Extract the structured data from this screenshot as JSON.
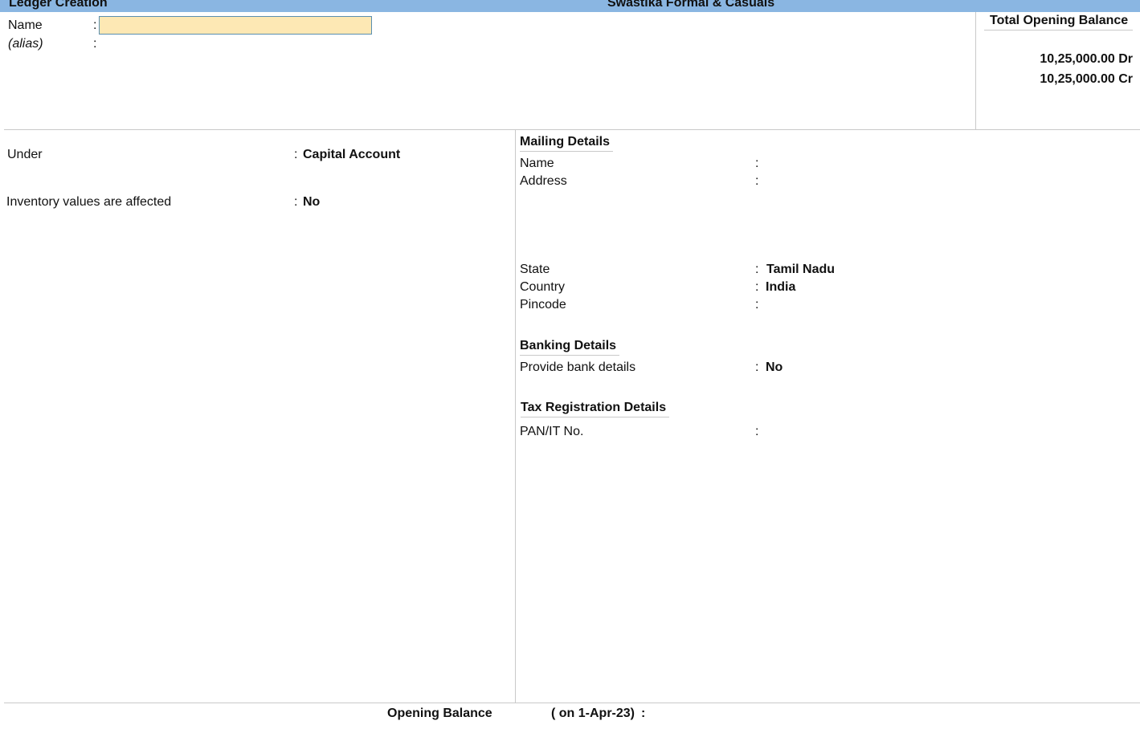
{
  "title_bar": {
    "screen_title": "Ledger Creation",
    "company_name": "Swastika Formal & Casuals"
  },
  "header": {
    "name_label": "Name",
    "alias_label": "(alias)",
    "separator": ":",
    "name_value": ""
  },
  "opening_balance_panel": {
    "title": "Total Opening Balance",
    "debit_total": "10,25,000.00 Dr",
    "credit_total": "10,25,000.00 Cr"
  },
  "left_panel": {
    "under_label": "Under",
    "under_value": "Capital Account",
    "inventory_label": "Inventory values are affected",
    "inventory_value": "No"
  },
  "mailing_details": {
    "title": "Mailing Details",
    "name_label": "Name",
    "address_label": "Address",
    "state_label": "State",
    "state_value": "Tamil Nadu",
    "country_label": "Country",
    "country_value": "India",
    "pincode_label": "Pincode"
  },
  "banking_details": {
    "title": "Banking Details",
    "provide_label": "Provide bank details",
    "provide_value": "No"
  },
  "tax_details": {
    "title": "Tax Registration Details",
    "pan_label": "PAN/IT No."
  },
  "footer": {
    "opening_balance_label": "Opening Balance",
    "date_label": "( on 1-Apr-23)",
    "separator": ":"
  },
  "colors": {
    "title_bar": "#8ab6e2",
    "input_active": "#fde8b4"
  }
}
